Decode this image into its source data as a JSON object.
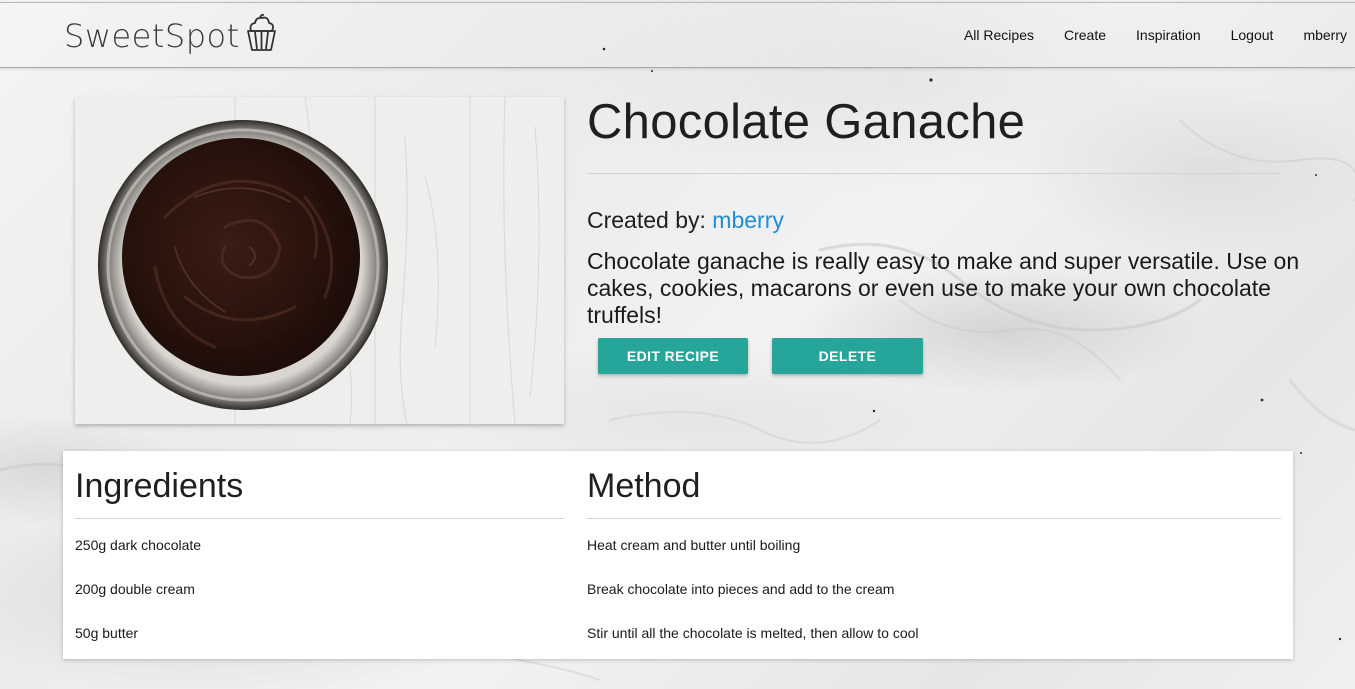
{
  "navbar": {
    "brand": "SweetSpot",
    "brand_icon": "cupcake-icon",
    "links": [
      "All Recipes",
      "Create",
      "Inspiration",
      "Logout",
      "mberry"
    ]
  },
  "recipe": {
    "title": "Chocolate Ganache",
    "image_icon": "chocolate-ganache-bowl-photo",
    "created_by_label": "Created by:",
    "author": "mberry",
    "description": "Chocolate ganache is really easy to make and super versatile. Use on cakes, cookies, macarons or even use to make your own chocolate truffels!",
    "edit_label": "EDIT RECIPE",
    "delete_label": "DELETE"
  },
  "ingredients": {
    "heading": "Ingredients",
    "items": [
      "250g dark chocolate",
      "200g double cream",
      "50g butter"
    ]
  },
  "method": {
    "heading": "Method",
    "steps": [
      "Heat cream and butter until boiling",
      "Break chocolate into pieces and add to the cream",
      "Stir until all the chocolate is melted, then allow to cool"
    ]
  },
  "colors": {
    "accent": "#26a69a",
    "link": "#1e8fd6",
    "background": "#eeeeee"
  }
}
